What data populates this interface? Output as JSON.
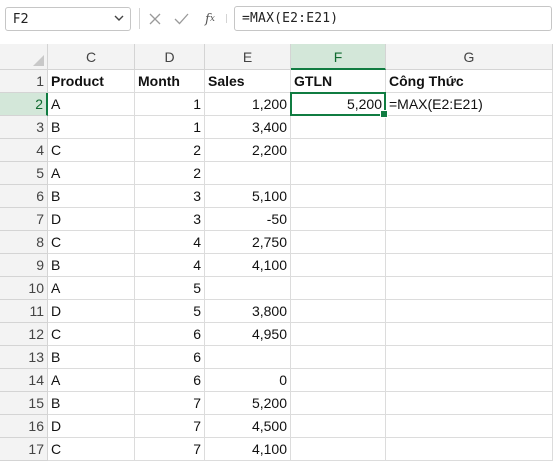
{
  "name_box": "F2",
  "formula_bar": "=MAX(E2:E21)",
  "icons": {
    "name_box_dropdown": "chevron-down-icon",
    "cancel": "close-icon",
    "enter": "check-icon",
    "insert_function": "function-icon"
  },
  "accent_color": "#107c41",
  "columns": [
    "C",
    "D",
    "E",
    "F",
    "G"
  ],
  "selected_column": "F",
  "selected_row": "2",
  "rows": [
    {
      "num": "1",
      "c": "Product",
      "d": "Month",
      "e": "Sales",
      "f": "GTLN",
      "g": "Công Thức"
    },
    {
      "num": "2",
      "c": "A",
      "d": "1",
      "e": "1,200",
      "f": "5,200",
      "g": "=MAX(E2:E21)"
    },
    {
      "num": "3",
      "c": "B",
      "d": "1",
      "e": "3,400",
      "f": "",
      "g": ""
    },
    {
      "num": "4",
      "c": "C",
      "d": "2",
      "e": "2,200",
      "f": "",
      "g": ""
    },
    {
      "num": "5",
      "c": "A",
      "d": "2",
      "e": "",
      "f": "",
      "g": ""
    },
    {
      "num": "6",
      "c": "B",
      "d": "3",
      "e": "5,100",
      "f": "",
      "g": ""
    },
    {
      "num": "7",
      "c": "D",
      "d": "3",
      "e": "-50",
      "f": "",
      "g": ""
    },
    {
      "num": "8",
      "c": "C",
      "d": "4",
      "e": "2,750",
      "f": "",
      "g": ""
    },
    {
      "num": "9",
      "c": "B",
      "d": "4",
      "e": "4,100",
      "f": "",
      "g": ""
    },
    {
      "num": "10",
      "c": "A",
      "d": "5",
      "e": "",
      "f": "",
      "g": ""
    },
    {
      "num": "11",
      "c": "D",
      "d": "5",
      "e": "3,800",
      "f": "",
      "g": ""
    },
    {
      "num": "12",
      "c": "C",
      "d": "6",
      "e": "4,950",
      "f": "",
      "g": ""
    },
    {
      "num": "13",
      "c": "B",
      "d": "6",
      "e": "",
      "f": "",
      "g": ""
    },
    {
      "num": "14",
      "c": "A",
      "d": "6",
      "e": "0",
      "f": "",
      "g": ""
    },
    {
      "num": "15",
      "c": "B",
      "d": "7",
      "e": "5,200",
      "f": "",
      "g": ""
    },
    {
      "num": "16",
      "c": "D",
      "d": "7",
      "e": "4,500",
      "f": "",
      "g": ""
    },
    {
      "num": "17",
      "c": "C",
      "d": "7",
      "e": "4,100",
      "f": "",
      "g": ""
    }
  ]
}
